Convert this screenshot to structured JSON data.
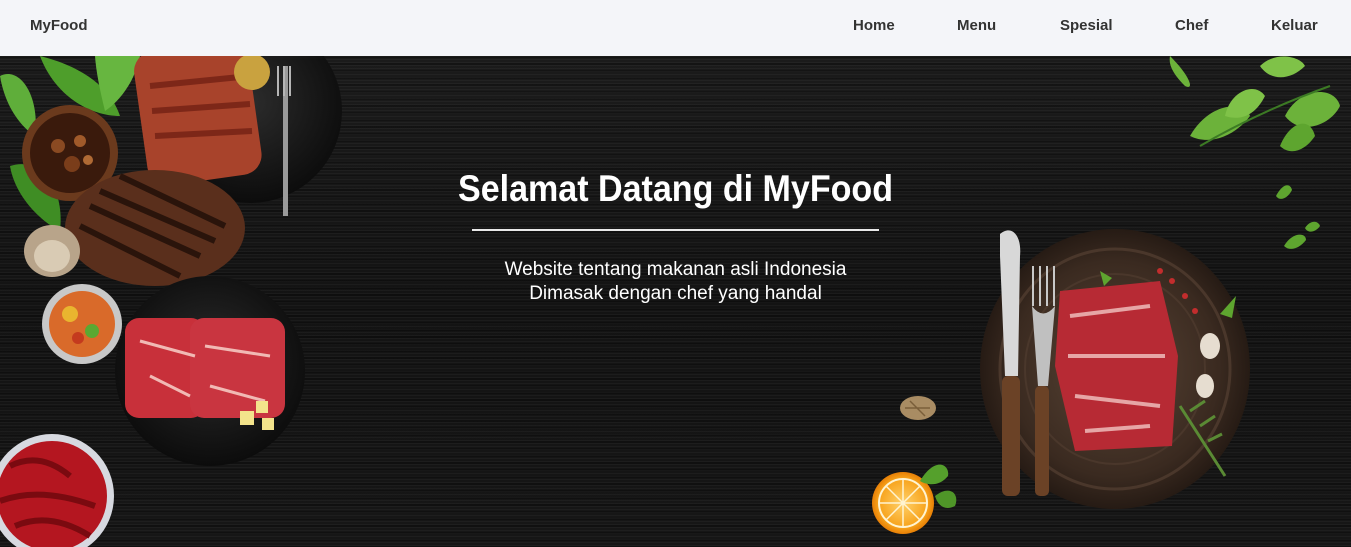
{
  "navbar": {
    "brand": "MyFood",
    "links": [
      "Home",
      "Menu",
      "Spesial",
      "Chef",
      "Keluar"
    ]
  },
  "hero": {
    "title": "Selamat Datang di MyFood",
    "line1": "Website tentang makanan asli Indonesia",
    "line2": "Dimasak dengan chef yang handal"
  },
  "colors": {
    "navbar_bg": "#f4f5f9",
    "hero_bg": "#151515",
    "text_dark": "#333333",
    "text_light": "#ffffff"
  }
}
